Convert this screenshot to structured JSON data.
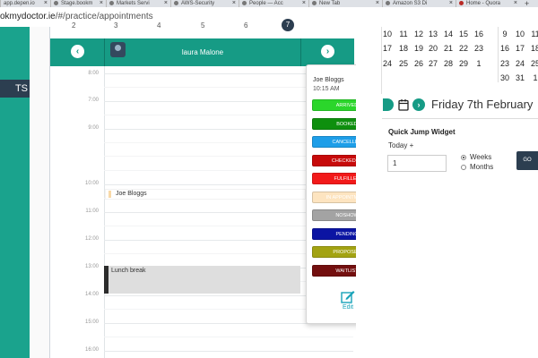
{
  "browser": {
    "tabs": [
      {
        "title": "app.depen.io"
      },
      {
        "title": "Stage.bookm"
      },
      {
        "title": "Markets Servi"
      },
      {
        "title": "AWS-Security"
      },
      {
        "title": "People — Acc"
      },
      {
        "title": "New Tab"
      },
      {
        "title": "Amazon S3 Di"
      },
      {
        "title": "Home - Quora"
      }
    ],
    "new_tab": "+",
    "url_host": "okmydoctor.ie",
    "url_path": "/#/practice/appointments"
  },
  "sidebar": {
    "active_label": "TS"
  },
  "calendar": {
    "day_numbers": [
      "2",
      "3",
      "4",
      "5",
      "6",
      "7"
    ],
    "provider_name": "laura Malone",
    "prev_arrow": "‹",
    "next_arrow": "›",
    "times": [
      "8:00",
      "7:00",
      "9:00",
      "10:00",
      "11:00",
      "12:00",
      "13:00",
      "14:00",
      "15:00",
      "16:00"
    ],
    "appointments": [
      {
        "label": "Joe Bloggs"
      },
      {
        "label": "Lunch break"
      }
    ]
  },
  "popover": {
    "close": "×",
    "patient": "Joe Bloggs",
    "time": "10:15 AM",
    "statuses": [
      {
        "label": "ARRIVED",
        "color": "#2bd62b"
      },
      {
        "label": "BOOKED",
        "color": "#0e8f0e"
      },
      {
        "label": "CANCELLED",
        "color": "#1e9ee8"
      },
      {
        "label": "CHECKED-IN",
        "color": "#c70a0a"
      },
      {
        "label": "FULFILLED",
        "color": "#f21a1a"
      },
      {
        "label": "IN APPOINTMENT",
        "color": "#fde4c0"
      },
      {
        "label": "NOSHOW",
        "color": "#a3a3a3"
      },
      {
        "label": "PENDING",
        "color": "#0b14a3"
      },
      {
        "label": "PROPOSED",
        "color": "#a3a312"
      },
      {
        "label": "WAITLIST",
        "color": "#730f0f"
      }
    ],
    "edit_label": "Edit"
  },
  "mini_calendar": {
    "left_rows": [
      [
        "10",
        "11",
        "12",
        "13",
        "14",
        "15",
        "16"
      ],
      [
        "17",
        "18",
        "19",
        "20",
        "21",
        "22",
        "23"
      ],
      [
        "24",
        "25",
        "26",
        "27",
        "28",
        "29",
        "1"
      ]
    ],
    "right_rows": [
      [
        "9",
        "10",
        "11"
      ],
      [
        "16",
        "17",
        "18"
      ],
      [
        "23",
        "24",
        "25"
      ],
      [
        "30",
        "31",
        "1"
      ]
    ]
  },
  "date_nav": {
    "date_title": "Friday 7th February",
    "next_arrow": "›"
  },
  "quick_jump": {
    "title": "Quick Jump Widget",
    "today_label": "Today +",
    "value": "1",
    "options": [
      {
        "label": "Weeks",
        "selected": true
      },
      {
        "label": "Months",
        "selected": false
      }
    ],
    "go_label": "GO"
  },
  "colors": {
    "brand_teal": "#169b85",
    "sidebar": "#1aa38d",
    "navy": "#2c3e50"
  }
}
